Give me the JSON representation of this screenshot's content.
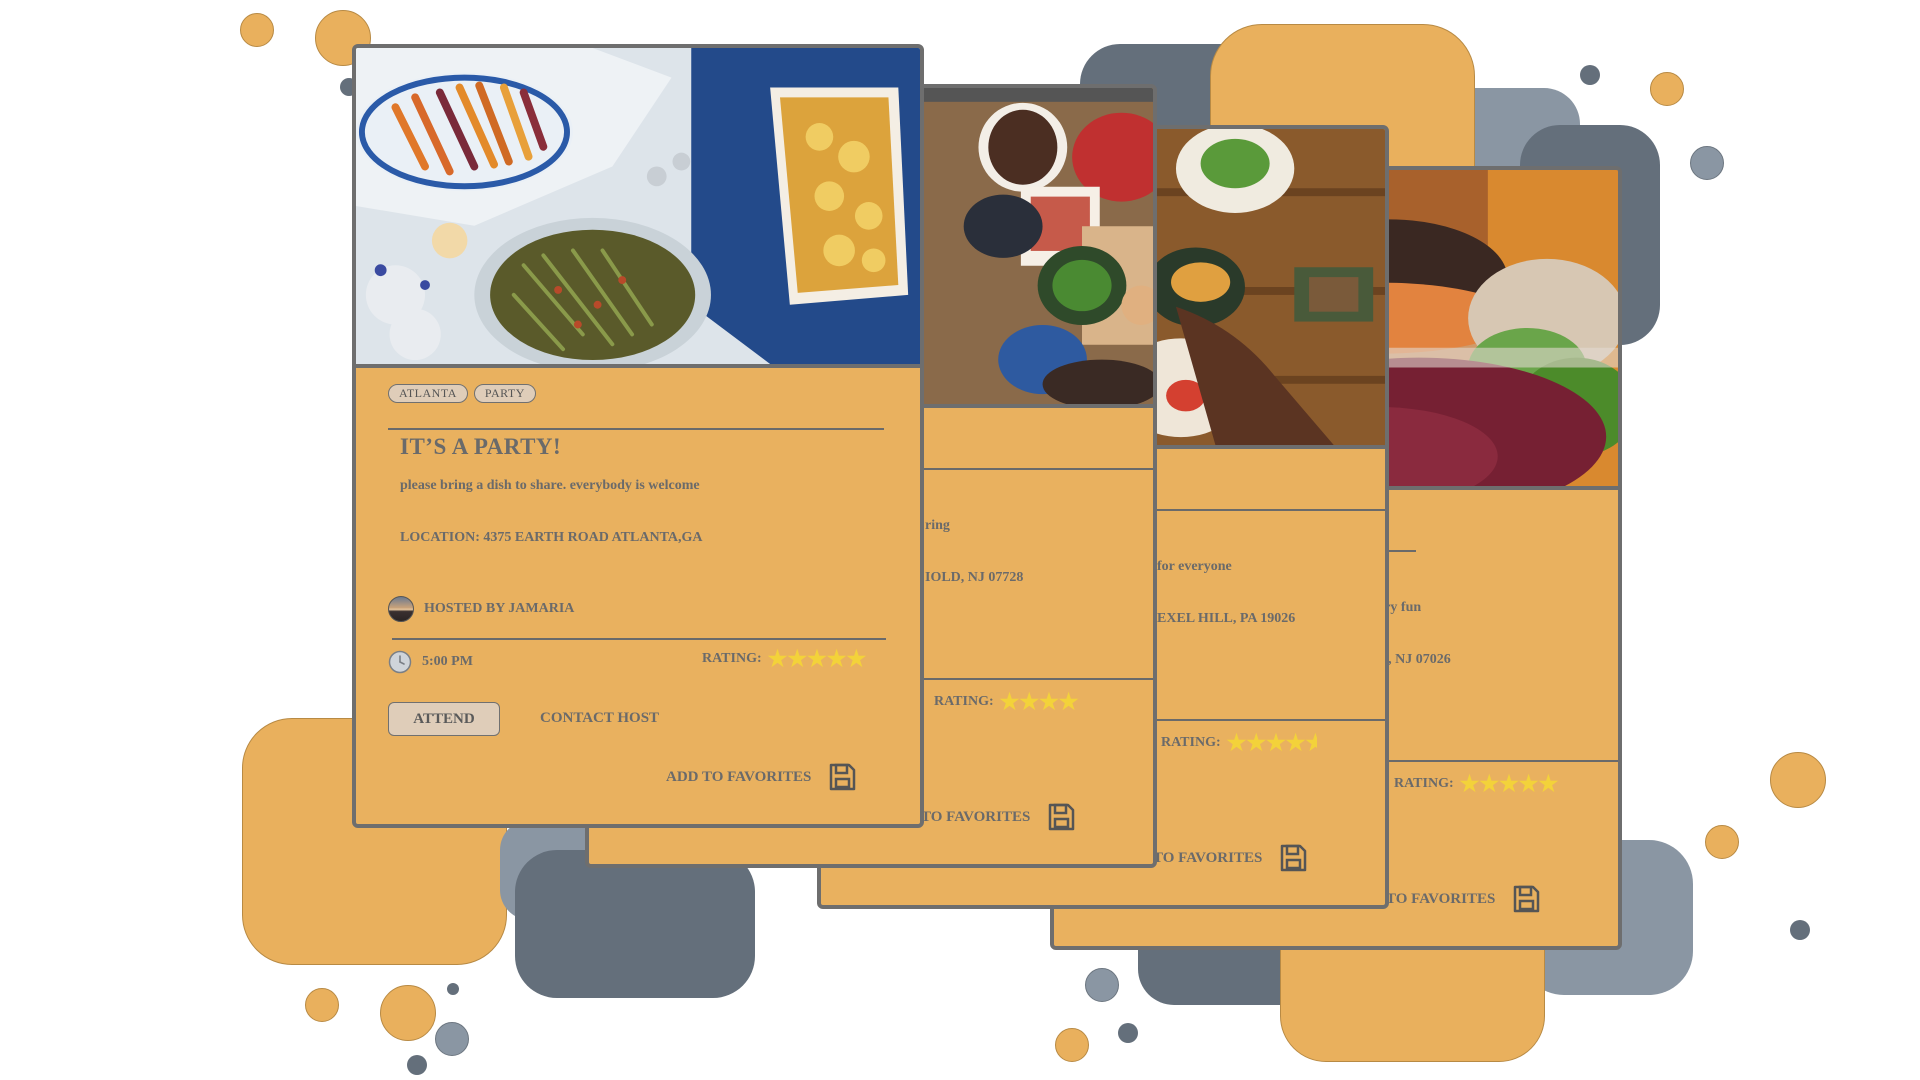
{
  "colors": {
    "card": "#e9b15f",
    "border": "#6e6e6e",
    "text": "#6a6a6a",
    "star": "#f3d23a",
    "deco_orange": "#e9b05d",
    "deco_slate": "#646f7b",
    "deco_gray": "#8a96a3"
  },
  "cards": [
    {
      "tags": [
        "ATLANTA",
        "PARTY"
      ],
      "title": "IT’S A PARTY!",
      "description": "please bring a dish to share. everybody is welcome",
      "location": "LOCATION: 4375 EARTH ROAD ATLANTA,GA",
      "host": "HOSTED BY JAMARIA",
      "time": "5:00 PM",
      "rating_label": "RATING:",
      "rating": 5,
      "attend_label": "ATTEND",
      "contact_label": "CONTACT HOST",
      "favorites_label": "ADD TO FAVORITES",
      "icons": [
        "clock-icon",
        "save-icon"
      ]
    },
    {
      "description": "ring",
      "location": "IOLD, NJ 07728",
      "rating_label": "RATING:",
      "rating": 4,
      "favorites_label": "TO FAVORITES"
    },
    {
      "description": "for everyone",
      "location": "EXEL HILL, PA 19026",
      "rating_label": "RATING:",
      "rating": 4.5,
      "favorites_label": "TO FAVORITES"
    },
    {
      "description": "ery fun",
      "location": "D, NJ 07026",
      "rating_label": "RATING:",
      "rating": 5,
      "favorites_label": "TO FAVORITES"
    }
  ]
}
